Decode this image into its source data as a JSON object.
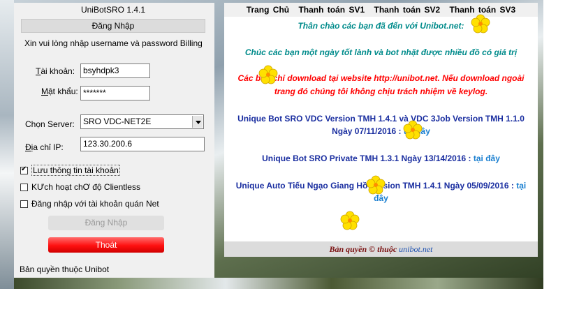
{
  "window": {
    "title": "UniBotSRO 1.4.1",
    "section": "Đăng Nhập",
    "prompt": "Xin vui lòng nhập username và password Billing"
  },
  "form": {
    "account_label_u": "T",
    "account_label_rest": "ài khoản:",
    "account_value": "bsyhdpk3",
    "password_label_u": "M",
    "password_label_rest": "ật khẩu:",
    "password_value": "*******",
    "server_label": "Chọn Server:",
    "server_value": "SRO VDC-NET2E",
    "ip_label_u": "Đ",
    "ip_label_rest": "ịa chỉ IP:",
    "ip_value": "123.30.200.6"
  },
  "checkboxes": [
    {
      "label": "Lưu thông tin tài khoản",
      "checked": true
    },
    {
      "label": "KƯch hoạt chƠ độ Clientless",
      "checked": false
    },
    {
      "label": "Đăng nhập với tài khoản quán Net",
      "checked": false
    }
  ],
  "buttons": {
    "login": "Đăng Nhập",
    "exit": "Thoát"
  },
  "footer_left": "Bản quyền thuộc Unibot",
  "web": {
    "nav": [
      "Trang Chủ",
      "Thanh toán SV1",
      "Thanh toán SV2",
      "Thanh toán SV3"
    ],
    "welcome": "Thân chào các bạn đã đến với Unibot.net:",
    "wish": "Chúc các bạn một ngày tốt lành và bot nhặt được nhiều đồ có giá trị",
    "warning_line1": "Các bạn chỉ download tại website http://unibot.net. Nếu download ngoài",
    "warning_line2": "trang đó chúng tôi không chịu trách nhiệm về keylog.",
    "link1_line1": "Unique Bot SRO VDC Version TMH 1.4.1 và VDC 3Job Version TMH 1.1.0",
    "link1_line2": "Ngày 07/11/2016 :",
    "link1_here": "tại đây",
    "link2_text": "Unique Bot SRO Private TMH 1.3.1 Ngày 13/14/2016 :",
    "link2_here": "tại đây",
    "link3_line1": "Unique Auto Tiếu Ngạo Giang Hồ Version TMH 1.4.1 Ngày 05/09/2016 :",
    "link3_here1": "tại",
    "link3_here2": "đây",
    "copyright": "Bản quyền © thuộc",
    "copyright_link": "unibot.net"
  },
  "colors": {
    "teal": "#008b8b",
    "red": "#ff0000",
    "blue": "#1a2ea0",
    "exit_button": "#ff1010"
  }
}
